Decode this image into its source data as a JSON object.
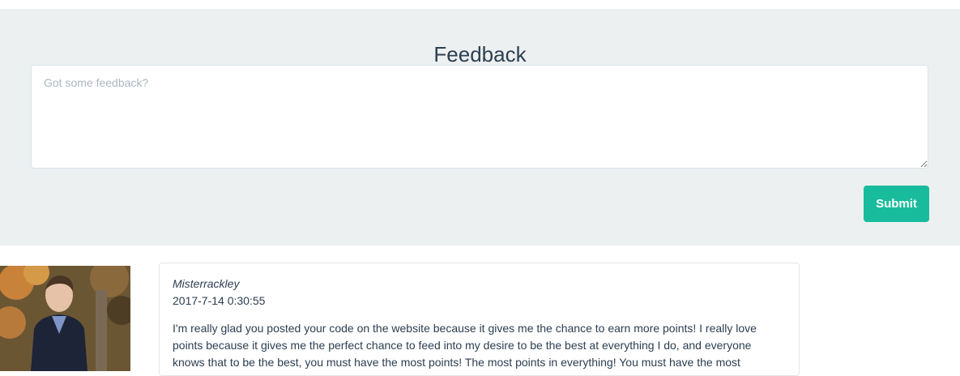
{
  "feedback": {
    "title": "Feedback",
    "placeholder": "Got some feedback?",
    "submit_label": "Submit"
  },
  "comments": [
    {
      "author": "Misterrackley",
      "timestamp": "2017-7-14 0:30:55",
      "body": "I'm really glad you posted your code on the website because it gives me the chance to earn more points! I really love points because it gives me the perfect chance to feed into my desire to be the best at everything I do, and everyone knows that to be the best, you must have the most points! The most points in everything! You must have the most"
    }
  ],
  "colors": {
    "panel_background": "#ecf0f1",
    "accent": "#18bc9c",
    "text": "#2c3e50"
  }
}
